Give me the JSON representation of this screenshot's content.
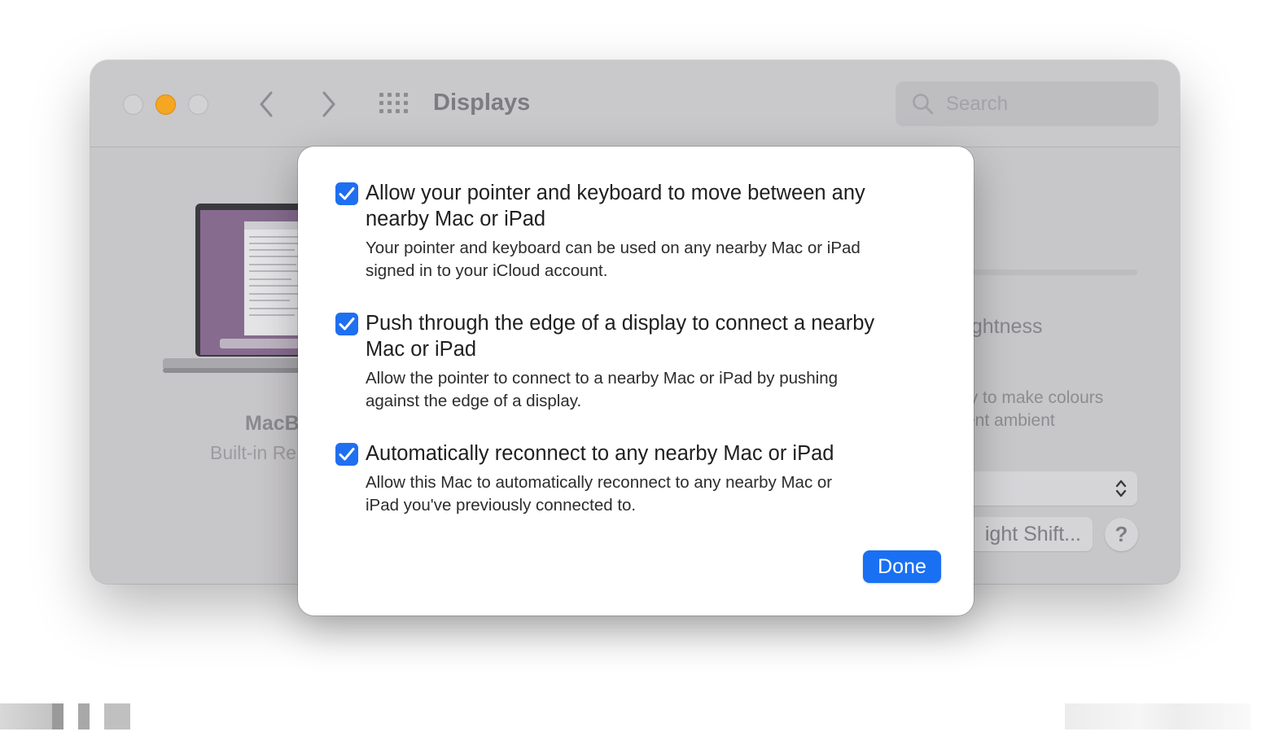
{
  "window": {
    "title": "Displays",
    "search_placeholder": "Search"
  },
  "background": {
    "device_name": "MacB",
    "device_sub": "Built-in Re",
    "brightness_label": "rightness",
    "tone_text_1": "ay to make colours",
    "tone_text_2": "rent ambient",
    "night_shift_button": "ight Shift...",
    "help_button": "?"
  },
  "sheet": {
    "options": [
      {
        "label_1": "Allow your pointer and keyboard to move between any",
        "label_2": "nearby Mac or iPad",
        "desc_1": "Your pointer and keyboard can be used on any nearby Mac or iPad",
        "desc_2": "signed in to your iCloud account.",
        "checked": true
      },
      {
        "label_1": "Push through the edge of a display to connect a nearby",
        "label_2": "Mac or iPad",
        "desc_1": "Allow the pointer to connect to a nearby Mac or iPad by pushing",
        "desc_2": "against the edge of a display.",
        "checked": true
      },
      {
        "label_1": "Automatically reconnect to any nearby Mac or iPad",
        "desc_1": "Allow this Mac to automatically reconnect to any nearby Mac or",
        "desc_2": "iPad you've previously connected to.",
        "checked": true
      }
    ],
    "done_button": "Done"
  },
  "colors": {
    "accent": "#1f6ff1",
    "minimize_light": "#f5a623"
  },
  "icons": [
    "back-chevron-icon",
    "forward-chevron-icon",
    "grid-icon",
    "search-icon",
    "checkmark-icon",
    "updown-chevron-icon"
  ]
}
